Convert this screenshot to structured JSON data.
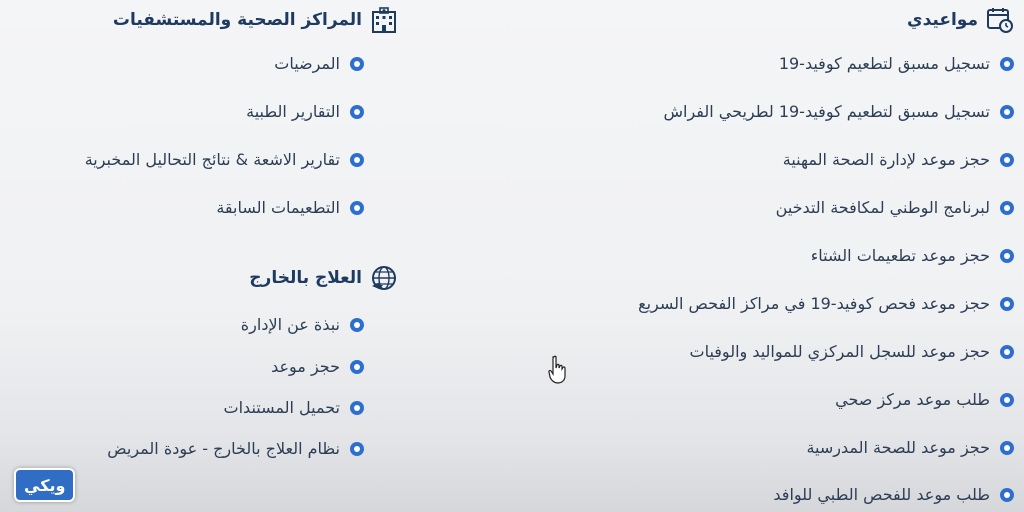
{
  "appointments": {
    "title": "مواعيدي",
    "icon": "calendar-clock-icon",
    "items": [
      "تسجيل مسبق لتطعيم كوفيد-19",
      "تسجيل مسبق لتطعيم كوفيد-19 لطريحي الفراش",
      "حجز موعد لإدارة الصحة المهنية",
      "لبرنامج الوطني لمكافحة التدخين",
      "حجز موعد تطعيمات الشتاء",
      "حجز موعد فحص كوفيد-19 في مراكز الفحص السريع",
      "حجز موعد للسجل المركزي للمواليد والوفيات",
      "طلب موعد مركز صحي",
      "حجز موعد للصحة المدرسية",
      "طلب موعد للفحص الطبي للوافد"
    ]
  },
  "health_centers": {
    "title": "المراكز الصحية والمستشفيات",
    "icon": "hospital-building-icon",
    "items": [
      "المرضيات",
      "التقارير الطبية",
      "تقارير الاشعة & نتائج التحاليل المخبرية",
      "التطعيمات السابقة"
    ]
  },
  "treatment_abroad": {
    "title": "العلاج بالخارج",
    "icon": "globe-plane-icon",
    "items": [
      "نبذة عن الإدارة",
      "حجز موعد",
      "تحميل المستندات",
      "نظام العلاج بالخارج - عودة المريض"
    ]
  },
  "watermark": "ويكي",
  "colors": {
    "heading": "#1f3a5f",
    "text": "#2c3e55",
    "bullet": "#2d6fcf",
    "background": "#f4f5f7"
  }
}
